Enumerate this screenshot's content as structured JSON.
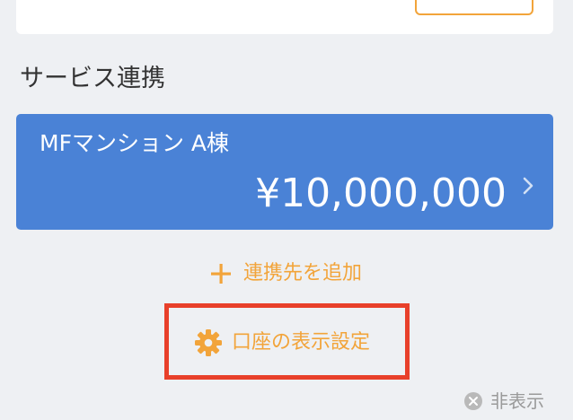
{
  "section": {
    "title": "サービス連携"
  },
  "service": {
    "name": "MFマンション A棟",
    "amount": "¥10,000,000"
  },
  "actions": {
    "add_label": "連携先を追加",
    "settings_label": "口座の表示設定",
    "hide_label": "非表示"
  },
  "colors": {
    "card_blue": "#4a82d6",
    "accent_orange": "#f2a43a",
    "highlight_red": "#e8402a",
    "muted_gray": "#9a9a9a"
  },
  "icons": [
    "plus-icon",
    "gear-icon",
    "chevron-right-icon",
    "close-circle-icon"
  ]
}
